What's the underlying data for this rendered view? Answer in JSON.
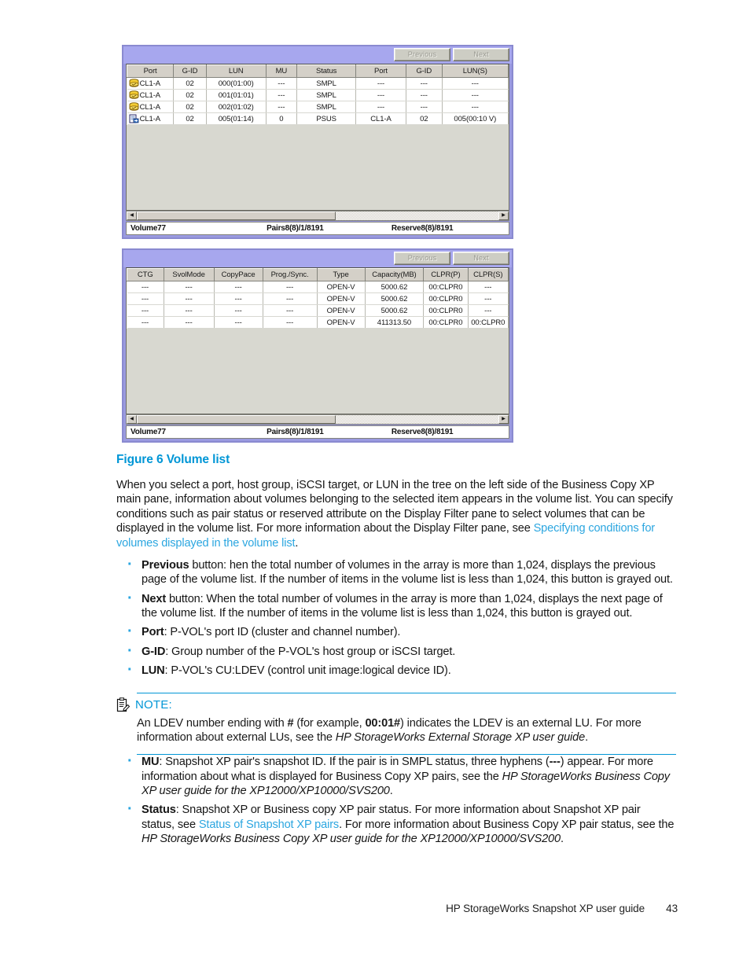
{
  "figure": {
    "panels": [
      {
        "id": "pvol-panel",
        "pager": {
          "previous": "Previous",
          "next": "Next"
        },
        "columns": [
          "Port",
          "G-ID",
          "LUN",
          "MU",
          "Status",
          "Port",
          "G-ID",
          "LUN(S)"
        ],
        "rows": [
          {
            "icon": "volume-icon",
            "cells": [
              "CL1-A",
              "02",
              "000(01:00)",
              "---",
              "SMPL",
              "---",
              "---",
              "---"
            ]
          },
          {
            "icon": "volume-icon",
            "cells": [
              "CL1-A",
              "02",
              "001(01:01)",
              "---",
              "SMPL",
              "---",
              "---",
              "---"
            ]
          },
          {
            "icon": "volume-icon",
            "cells": [
              "CL1-A",
              "02",
              "002(01:02)",
              "---",
              "SMPL",
              "---",
              "---",
              "---"
            ]
          },
          {
            "icon": "pair-pvol-icon",
            "cells": [
              "CL1-A",
              "02",
              "005(01:14)",
              "0",
              "PSUS",
              "CL1-A",
              "02",
              "005(00:10 V)"
            ]
          }
        ],
        "status": {
          "volume": "Volume77",
          "pairs": "Pairs8(8)/1/8191",
          "reserve": "Reserve8(8)/8191"
        }
      },
      {
        "id": "detail-panel",
        "pager": {
          "previous": "Previous",
          "next": "Next"
        },
        "columns": [
          "CTG",
          "SvolMode",
          "CopyPace",
          "Prog./Sync.",
          "Type",
          "Capacity(MB)",
          "CLPR(P)",
          "CLPR(S)"
        ],
        "rows": [
          {
            "icon": "",
            "cells": [
              "---",
              "---",
              "---",
              "---",
              "OPEN-V",
              "5000.62",
              "00:CLPR0",
              "---"
            ]
          },
          {
            "icon": "",
            "cells": [
              "---",
              "---",
              "---",
              "---",
              "OPEN-V",
              "5000.62",
              "00:CLPR0",
              "---"
            ]
          },
          {
            "icon": "",
            "cells": [
              "---",
              "---",
              "---",
              "---",
              "OPEN-V",
              "5000.62",
              "00:CLPR0",
              "---"
            ]
          },
          {
            "icon": "",
            "cells": [
              "---",
              "---",
              "---",
              "---",
              "OPEN-V",
              "411313.50",
              "00:CLPR0",
              "00:CLPR0"
            ]
          }
        ],
        "status": {
          "volume": "Volume77",
          "pairs": "Pairs8(8)/1/8191",
          "reserve": "Reserve8(8)/8191"
        }
      }
    ]
  },
  "doc": {
    "caption": "Figure 6 Volume list",
    "intro_1": "When you select a port, host group, iSCSI target, or LUN in the tree on the left side of the Business Copy XP main pane, information about volumes belonging to the selected item appears in the volume list.  You can specify conditions such as pair status or reserved attribute on the Display Filter pane to select volumes that can be displayed in the volume list.  For more information about the Display Filter pane, see ",
    "intro_link": "Specifying conditions for volumes displayed in the volume list",
    "intro_end": ".",
    "bullets": [
      {
        "term": "Previous",
        "text": " button: hen the total number of volumes in the array is more than 1,024, displays the previous page of the volume list.  If the number of items in the volume list is less than 1,024, this button is grayed out."
      },
      {
        "term": "Next",
        "text": " button:  When the total number of volumes in the array is more than 1,024, displays the next page of the volume list.  If the number of items in the volume list is less than 1,024, this button is grayed out."
      },
      {
        "term": "Port",
        "text": ":  P-VOL's port ID (cluster and channel number)."
      },
      {
        "term": "G-ID",
        "text": ": Group number of the P-VOL's host group or iSCSI target."
      },
      {
        "term": "LUN",
        "text": ": P-VOL's CU:LDEV (control unit image:logical device ID)."
      }
    ],
    "note": {
      "icon": "note-clipboard-icon",
      "title": "NOTE:",
      "text_1": "An LDEV number ending with ",
      "hash": "#",
      "text_2": " (for example, ",
      "example": "00:01#",
      "text_3": ") indicates the LDEV is an external LU. For more information about external LUs, see the ",
      "italic": "HP StorageWorks External Storage XP user guide",
      "text_4": "."
    },
    "tail_bullets": [
      {
        "term": "MU",
        "text_1": ": Snapshot XP pair's snapshot ID. If the pair is in SMPL status, three hyphens (",
        "bold_mid": "---",
        "text_2": ") appear. For more information about what is displayed for Business Copy XP pairs, see the ",
        "italic": "HP StorageWorks Business Copy XP user guide for the XP12000/XP10000/SVS200",
        "text_3": "."
      },
      {
        "term": "Status",
        "text_1": ": Snapshot XP or Business copy XP pair status.  For more information about Snapshot XP pair status, see ",
        "link": "Status of Snapshot XP pairs",
        "text_2": ".  For more information about Business Copy XP pair status, see the ",
        "italic": "HP StorageWorks Business Copy XP user guide for the XP12000/XP10000/SVS200",
        "text_3": "."
      }
    ]
  },
  "footer": {
    "guide": "HP StorageWorks Snapshot XP user guide",
    "page": "43"
  },
  "colors": {
    "accent_blue": "#0096d6",
    "link_blue": "#2ba6e0",
    "panel_border": "#8a8ad0",
    "panel_titlebar": "#a7a7ee",
    "grid_header": "#d4d0c8",
    "grid_filler": "#d8d8d0"
  }
}
